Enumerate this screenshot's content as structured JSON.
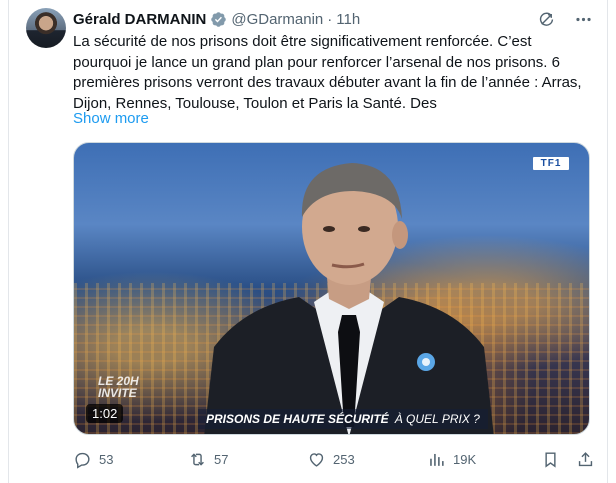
{
  "author": {
    "name": "Gérald DARMANIN",
    "handle": "@GDarmanin",
    "separator": "·",
    "time": "11h"
  },
  "icons": {
    "verified": "verified-badge-icon",
    "grok": "grok-icon",
    "more": "more-icon",
    "reply": "reply-icon",
    "repost": "repost-icon",
    "like": "like-icon",
    "views": "views-icon",
    "bookmark": "bookmark-icon",
    "share": "share-icon"
  },
  "colors": {
    "link": "#1d9bf0",
    "verified_badge": "#829aab",
    "muted": "#536471"
  },
  "tweet": {
    "text": "La sécurité de nos prisons doit être significativement renforcée. C’est pourquoi je lance un grand plan pour renforcer l’arsenal de nos prisons. 6 premières prisons verront des travaux débuter avant la fin de l’année : Arras, Dijon, Rennes, Toulouse, Toulon et Paris la Santé. Des",
    "show_more": "Show more"
  },
  "media": {
    "duration": "1:02",
    "channel_logo": "TF1",
    "show_tag_line1": "LE 20H",
    "show_tag_line2": "INVITE",
    "banner_main": "PRISONS DE HAUTE SÉCURITÉ",
    "banner_sub": "À QUEL PRIX ?"
  },
  "stats": {
    "replies": "53",
    "reposts": "57",
    "likes": "253",
    "views": "19K"
  }
}
